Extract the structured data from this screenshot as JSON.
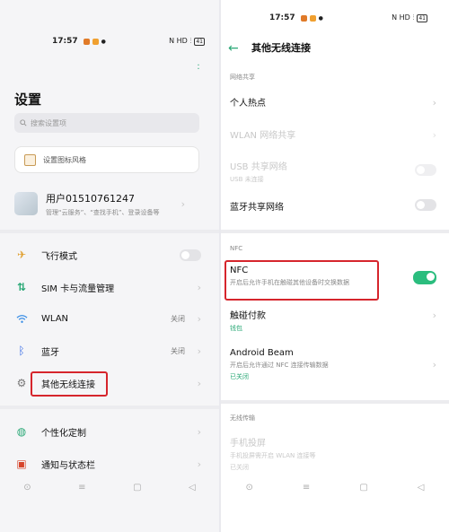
{
  "left": {
    "status": {
      "time": "17:57",
      "network": "N HD ⫶ ",
      "battery": "41"
    },
    "title": "设置",
    "search_placeholder": "搜索设置项",
    "style_card": "设置图标风格",
    "account": {
      "name": "用户01510761247",
      "sub": "管理“云服务”、“查找手机”、登录设备等"
    },
    "rows": [
      {
        "label": "飞行模式",
        "icon": "airplane-icon",
        "value": ""
      },
      {
        "label": "SIM 卡与流量管理",
        "icon": "sim-icon",
        "value": ""
      },
      {
        "label": "WLAN",
        "icon": "wifi-icon",
        "value": "关闭"
      },
      {
        "label": "蓝牙",
        "icon": "bluetooth-icon",
        "value": "关闭"
      },
      {
        "label": "其他无线连接",
        "icon": "connection-icon",
        "value": ""
      },
      {
        "label": "个性化定制",
        "icon": "palette-icon",
        "value": ""
      },
      {
        "label": "通知与状态栏",
        "icon": "notification-icon",
        "value": ""
      }
    ]
  },
  "right": {
    "status": {
      "time": "17:57",
      "network": "N HD ⫶ ",
      "battery": "41"
    },
    "title": "其他无线连接",
    "sections": {
      "share": "网络共享",
      "nfc": "NFC",
      "wireless": "无线传输"
    },
    "items": {
      "hotspot": {
        "title": "个人热点"
      },
      "wlan_share": {
        "title": "WLAN 网络共享"
      },
      "usb_share": {
        "title": "USB 共享网络",
        "sub": "USB 未连接"
      },
      "bt_share": {
        "title": "蓝牙共享网络"
      },
      "nfc": {
        "title": "NFC",
        "sub": "开启后允许手机在触碰其他设备时交换数据"
      },
      "tap_pay": {
        "title": "触碰付款",
        "sub": "钱包"
      },
      "beam": {
        "title": "Android Beam",
        "sub": "开启后允许通过 NFC 连接传输数据",
        "status": "已关闭"
      },
      "mirror": {
        "title": "手机投屏",
        "sub": "手机投屏需开启 WLAN 连接等",
        "status": "已关闭"
      }
    }
  },
  "colors": {
    "accent": "#2aa876",
    "highlight": "#d6252c",
    "toggle_on": "#2bbd7e"
  }
}
